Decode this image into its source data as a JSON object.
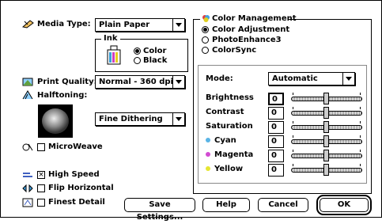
{
  "media_type": {
    "label": "Media Type:",
    "value": "Plain Paper"
  },
  "ink": {
    "title": "Ink",
    "options": [
      "Color",
      "Black"
    ],
    "selected": "Color"
  },
  "print_quality": {
    "label": "Print Quality:",
    "value": "Normal - 360 dpi"
  },
  "halftoning": {
    "label": "Halftoning:",
    "value": "Fine Dithering"
  },
  "microweave": {
    "label": "MicroWeave",
    "checked": false
  },
  "high_speed": {
    "label": "High Speed",
    "checked": true
  },
  "flip_horizontal": {
    "label": "Flip Horizontal",
    "checked": false
  },
  "finest_detail": {
    "label": "Finest Detail",
    "checked": false
  },
  "color_options": [
    "Color Management",
    "Color Adjustment",
    "PhotoEnhance3",
    "ColorSync"
  ],
  "color_selected": "Color Adjustment",
  "mode": {
    "label": "Mode:",
    "value": "Automatic"
  },
  "adjustments": [
    {
      "label": "Brightness",
      "value": "0",
      "dot": ""
    },
    {
      "label": "Contrast",
      "value": "0",
      "dot": ""
    },
    {
      "label": "Saturation",
      "value": "0",
      "dot": ""
    },
    {
      "label": "Cyan",
      "value": "0",
      "dot": "#5ab4e6"
    },
    {
      "label": "Magenta",
      "value": "0",
      "dot": "#d24bd2"
    },
    {
      "label": "Yellow",
      "value": "0",
      "dot": "#e6e632"
    }
  ],
  "buttons": {
    "save": "Save Settings...",
    "help": "Help",
    "cancel": "Cancel",
    "ok": "OK"
  }
}
